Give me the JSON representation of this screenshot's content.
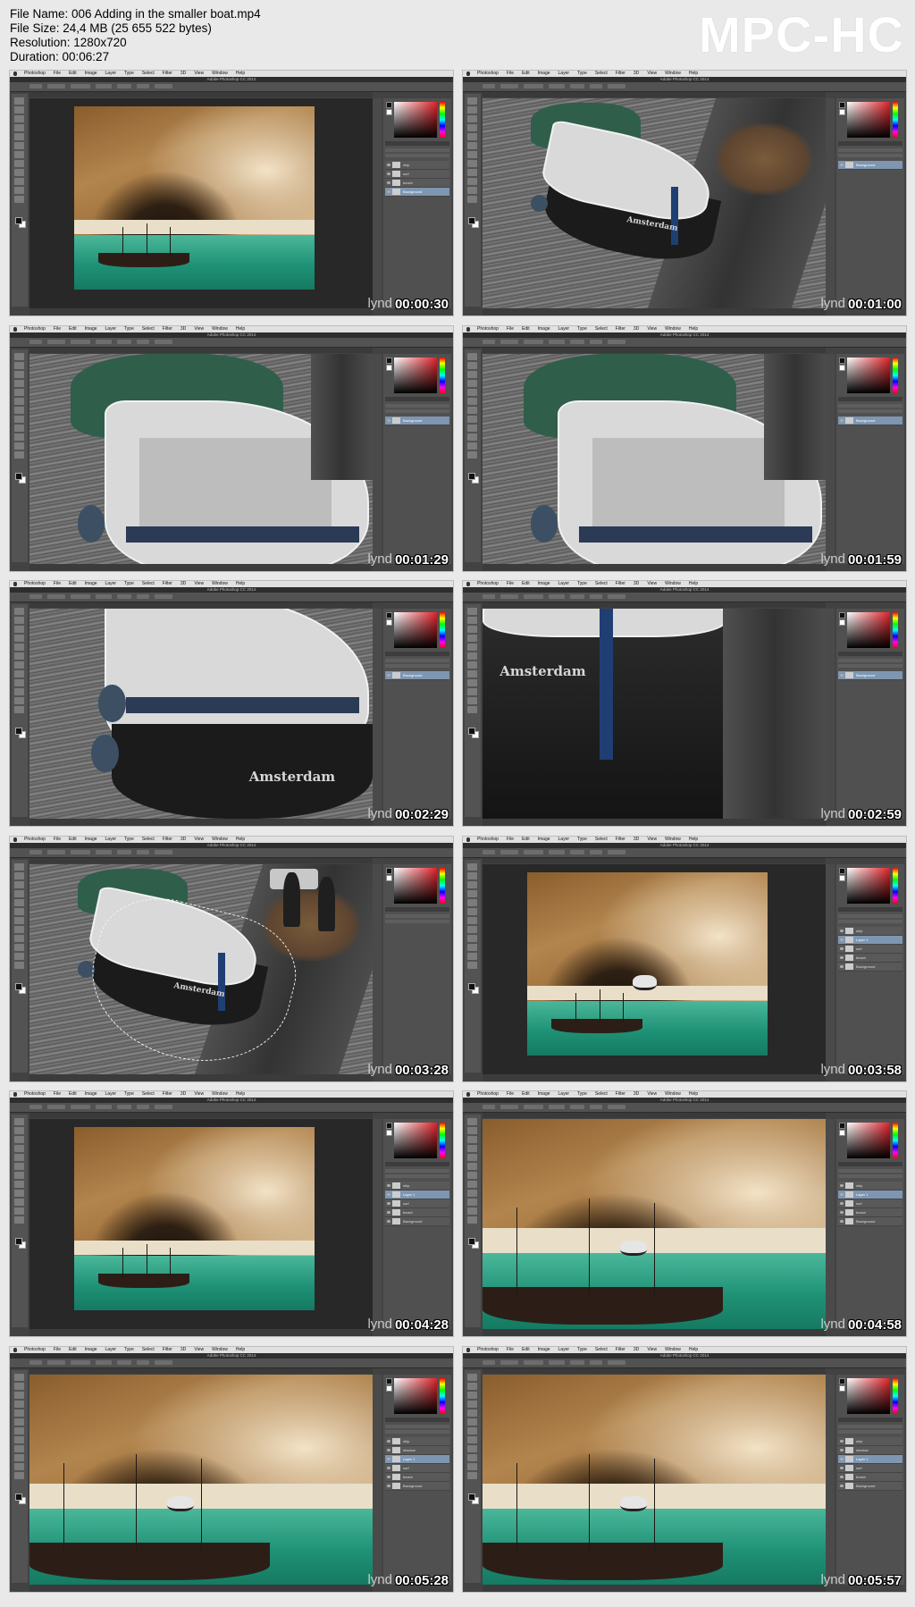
{
  "header": {
    "file_name": "File Name: 006 Adding in the smaller boat.mp4",
    "file_size": "File Size: 24,4 MB (25 655 522 bytes)",
    "resolution": "Resolution: 1280x720",
    "duration": "Duration: 00:06:27",
    "brand": "MPC-HC"
  },
  "app": {
    "menu": [
      "Photoshop",
      "File",
      "Edit",
      "Image",
      "Layer",
      "Type",
      "Select",
      "Filter",
      "3D",
      "View",
      "Window",
      "Help"
    ],
    "window_title": "Adobe Photoshop CC 2014",
    "watermark": "lynd"
  },
  "frames": [
    {
      "timestamp": "00:00:30",
      "scene": "cliff",
      "layers": [
        "ship",
        "surf",
        "beach",
        "Background"
      ],
      "selected_layer": 3
    },
    {
      "timestamp": "00:01:00",
      "scene": "canal-wide",
      "layers": [
        "Background"
      ],
      "selected_layer": 0
    },
    {
      "timestamp": "00:01:29",
      "scene": "boat-close",
      "layers": [
        "Background"
      ],
      "selected_layer": 0
    },
    {
      "timestamp": "00:01:59",
      "scene": "boat-close",
      "layers": [
        "Background"
      ],
      "selected_layer": 0
    },
    {
      "timestamp": "00:02:29",
      "scene": "boat-bow",
      "layers": [
        "Background"
      ],
      "selected_layer": 0
    },
    {
      "timestamp": "00:02:59",
      "scene": "hull-dark",
      "layers": [
        "Background"
      ],
      "selected_layer": 0
    },
    {
      "timestamp": "00:03:28",
      "scene": "canal-select",
      "layers": [],
      "selected_layer": -1
    },
    {
      "timestamp": "00:03:58",
      "scene": "cliff-boat",
      "layers": [
        "ship",
        "Layer 1",
        "surf",
        "beach",
        "Background"
      ],
      "selected_layer": 1
    },
    {
      "timestamp": "00:04:28",
      "scene": "cliff",
      "layers": [
        "ship",
        "Layer 1",
        "surf",
        "beach",
        "Background"
      ],
      "selected_layer": 1
    },
    {
      "timestamp": "00:04:58",
      "scene": "cliff-zoom",
      "layers": [
        "ship",
        "Layer 1",
        "surf",
        "beach",
        "Background"
      ],
      "selected_layer": 1
    },
    {
      "timestamp": "00:05:28",
      "scene": "cliff-zoom",
      "layers": [
        "ship",
        "shadow",
        "Layer 1",
        "surf",
        "beach",
        "Background"
      ],
      "selected_layer": 2
    },
    {
      "timestamp": "00:05:57",
      "scene": "cliff-zoom",
      "layers": [
        "ship",
        "shadow",
        "Layer 1",
        "surf",
        "beach",
        "Background"
      ],
      "selected_layer": 2
    }
  ],
  "hull_name": "Amsterdam",
  "colors": {
    "photoshop_ui": "#424242",
    "layer_selected": "#7e96b1",
    "sea": "#1f9276",
    "cliff": "#b2854e",
    "tarp": "#2f5e4b"
  }
}
